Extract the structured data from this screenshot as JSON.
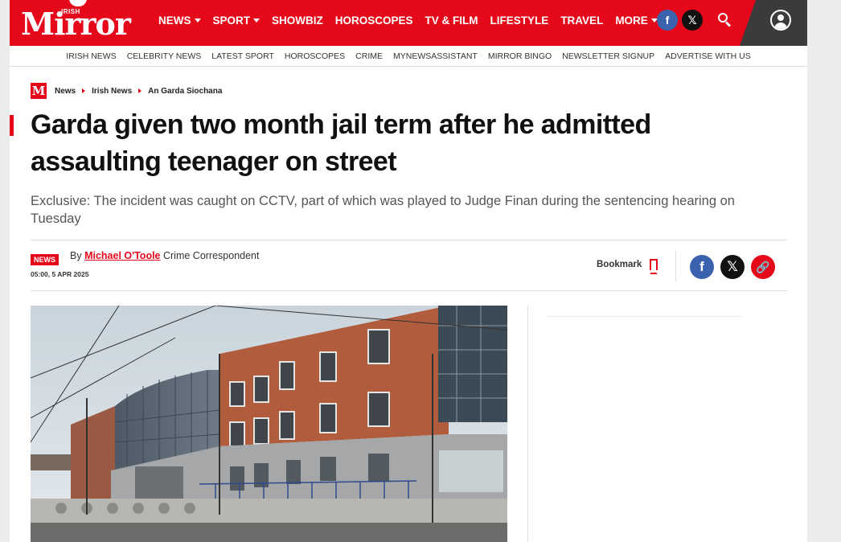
{
  "header": {
    "logo_small": "IRISH",
    "logo_main": "Mirror",
    "nav": [
      {
        "label": "NEWS",
        "dropdown": true
      },
      {
        "label": "SPORT",
        "dropdown": true
      },
      {
        "label": "SHOWBIZ",
        "dropdown": false
      },
      {
        "label": "HOROSCOPES",
        "dropdown": false
      },
      {
        "label": "TV & FILM",
        "dropdown": false
      },
      {
        "label": "LIFESTYLE",
        "dropdown": false
      },
      {
        "label": "TRAVEL",
        "dropdown": false
      },
      {
        "label": "MORE",
        "dropdown": true
      }
    ],
    "social": {
      "facebook": "f",
      "x": "𝕏"
    },
    "colors": {
      "brand": "#e5081a",
      "account_bg": "#3b3b3b",
      "facebook": "#3a62ad"
    }
  },
  "subnav": [
    "IRISH NEWS",
    "CELEBRITY NEWS",
    "LATEST SPORT",
    "HOROSCOPES",
    "CRIME",
    "MYNEWSASSISTANT",
    "MIRROR BINGO",
    "NEWSLETTER SIGNUP",
    "ADVERTISE WITH US"
  ],
  "breadcrumb": {
    "logo": "M",
    "items": [
      "News",
      "Irish News",
      "An Garda Siochana"
    ]
  },
  "article": {
    "headline": "Garda given two month jail term after he admitted assaulting teenager on street",
    "standfirst": "Exclusive: The incident was caught on CCTV, part of which was played to Judge Finan during the sentencing hearing on Tuesday",
    "badge": "NEWS",
    "by": "By",
    "author": "Michael O'Toole",
    "role": "Crime Correspondent",
    "date": "05:00, 5 APR 2025",
    "bookmark_label": "Bookmark",
    "share": {
      "facebook": "f",
      "x": "𝕏",
      "link": "🔗"
    }
  }
}
